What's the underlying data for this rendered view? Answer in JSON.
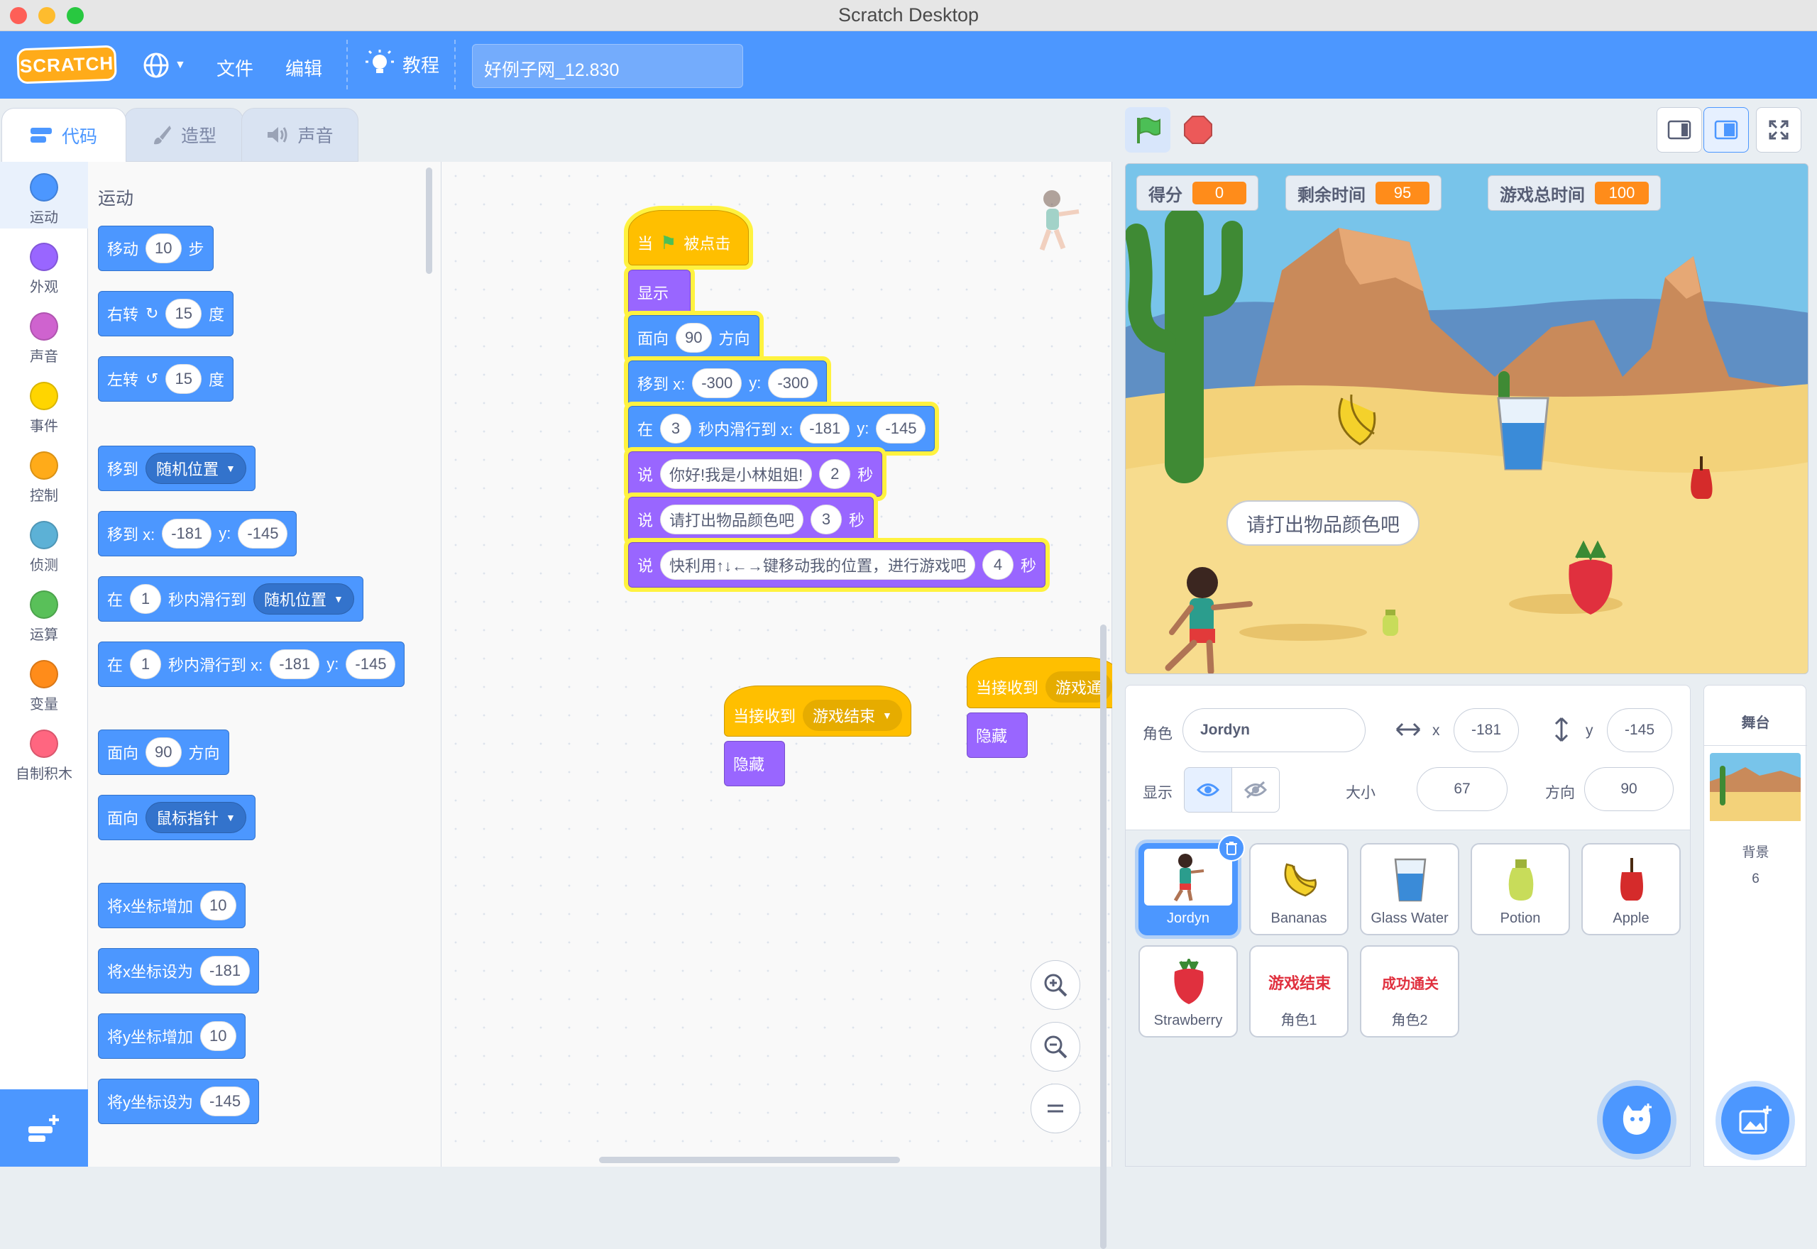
{
  "window": {
    "title": "Scratch Desktop"
  },
  "menubar": {
    "logo": "SCRATCH",
    "file": "文件",
    "edit": "编辑",
    "tutorials": "教程",
    "project_title": "好例子网_12.830"
  },
  "tabs": {
    "code": "代码",
    "costumes": "造型",
    "sounds": "声音"
  },
  "categories": [
    {
      "label": "运动",
      "color": "#4c97ff"
    },
    {
      "label": "外观",
      "color": "#9966ff"
    },
    {
      "label": "声音",
      "color": "#cf63cf"
    },
    {
      "label": "事件",
      "color": "#ffd500"
    },
    {
      "label": "控制",
      "color": "#ffab19"
    },
    {
      "label": "侦测",
      "color": "#5cb1d6"
    },
    {
      "label": "运算",
      "color": "#59c059"
    },
    {
      "label": "变量",
      "color": "#ff8c1a"
    },
    {
      "label": "自制积木",
      "color": "#ff6680"
    }
  ],
  "palette": {
    "heading": "运动",
    "move": {
      "a": "移动",
      "v": "10",
      "b": "步"
    },
    "turn_right": {
      "a": "右转",
      "v": "15",
      "b": "度"
    },
    "turn_left": {
      "a": "左转",
      "v": "15",
      "b": "度"
    },
    "goto": {
      "a": "移到",
      "d": "随机位置"
    },
    "goto_xy": {
      "a": "移到 x:",
      "x": "-181",
      "b": "y:",
      "y": "-145"
    },
    "glide": {
      "a": "在",
      "v": "1",
      "b": "秒内滑行到",
      "d": "随机位置"
    },
    "glide_xy": {
      "a": "在",
      "v": "1",
      "b": "秒内滑行到 x:",
      "x": "-181",
      "c": "y:",
      "y": "-145"
    },
    "point": {
      "a": "面向",
      "v": "90",
      "b": "方向"
    },
    "point_towards": {
      "a": "面向",
      "d": "鼠标指针"
    },
    "change_x": {
      "a": "将x坐标增加",
      "v": "10"
    },
    "set_x": {
      "a": "将x坐标设为",
      "v": "-181"
    },
    "change_y": {
      "a": "将y坐标增加",
      "v": "10"
    },
    "set_y": {
      "a": "将y坐标设为",
      "v": "-145"
    }
  },
  "script1": {
    "hat": {
      "a": "当",
      "b": "被点击"
    },
    "show": "显示",
    "point": {
      "a": "面向",
      "v": "90",
      "b": "方向"
    },
    "goto": {
      "a": "移到 x:",
      "x": "-300",
      "b": "y:",
      "y": "-300"
    },
    "glide": {
      "a": "在",
      "v": "3",
      "b": "秒内滑行到 x:",
      "x": "-181",
      "c": "y:",
      "y": "-145"
    },
    "say1": {
      "a": "说",
      "t": "你好!我是小林姐姐!",
      "v": "2",
      "b": "秒"
    },
    "say2": {
      "a": "说",
      "t": "请打出物品颜色吧",
      "v": "3",
      "b": "秒"
    },
    "say3": {
      "a": "说",
      "t": "快利用↑↓←→键移动我的位置，进行游戏吧",
      "v": "4",
      "b": "秒"
    }
  },
  "script2": {
    "hat": "当接收到",
    "msg": "游戏结束",
    "hide": "隐藏"
  },
  "script3": {
    "hat": "当接收到",
    "msg": "游戏通",
    "hide": "隐藏"
  },
  "stage": {
    "monitors": [
      {
        "label": "得分",
        "value": "0"
      },
      {
        "label": "剩余时间",
        "value": "95"
      },
      {
        "label": "游戏总时间",
        "value": "100"
      }
    ],
    "speech": "请打出物品颜色吧"
  },
  "sprite_info": {
    "sprite_label": "角色",
    "sprite_name": "Jordyn",
    "x_label": "x",
    "x": "-181",
    "y_label": "y",
    "y": "-145",
    "show_label": "显示",
    "size_label": "大小",
    "size": "67",
    "direction_label": "方向",
    "direction": "90"
  },
  "sprites": [
    {
      "name": "Jordyn"
    },
    {
      "name": "Bananas"
    },
    {
      "name": "Glass Water"
    },
    {
      "name": "Potion"
    },
    {
      "name": "Apple"
    },
    {
      "name": "Strawberry"
    },
    {
      "name": "角色1",
      "thumb_text": "游戏结束"
    },
    {
      "name": "角色2",
      "thumb_text": "成功通关"
    }
  ],
  "stage_pane": {
    "title": "舞台",
    "backdrop_label": "背景",
    "backdrop_count": "6"
  }
}
